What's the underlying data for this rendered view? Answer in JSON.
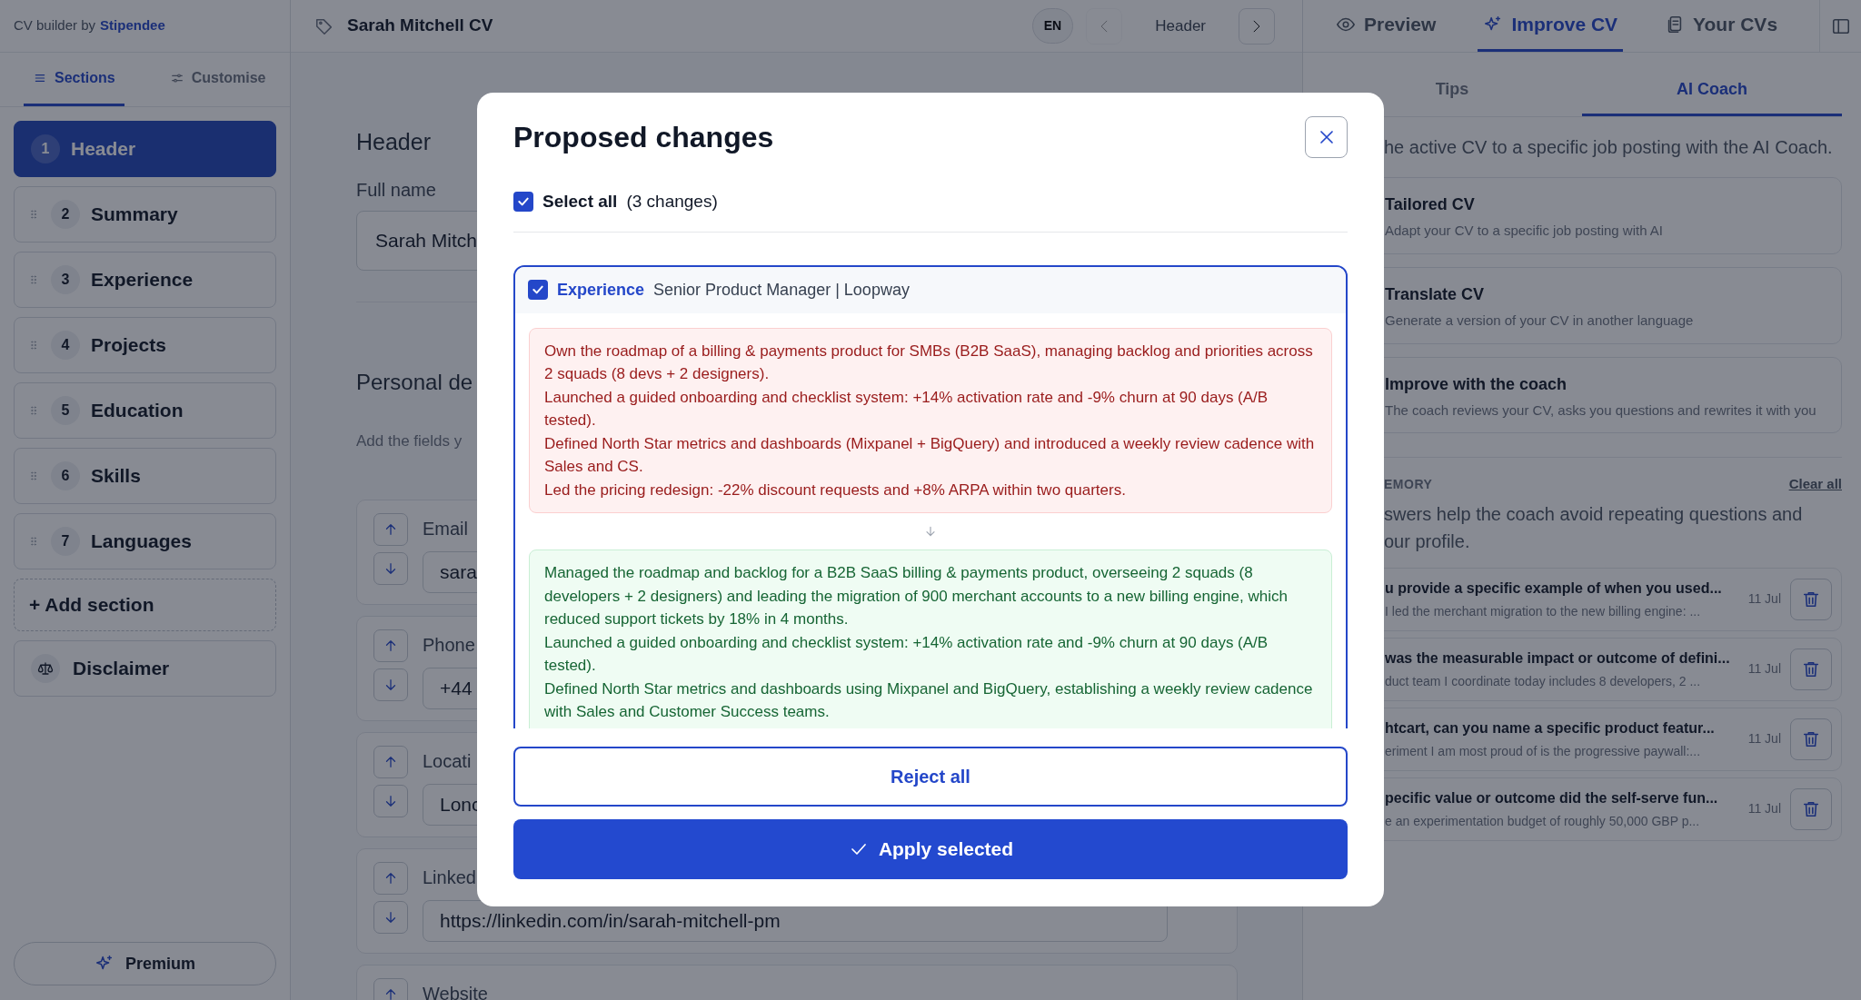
{
  "brand": {
    "prefix": "CV builder by",
    "name": "Stipendee"
  },
  "sidebar": {
    "tabs": [
      {
        "label": "Sections",
        "selected": true
      },
      {
        "label": "Customise",
        "selected": false
      }
    ],
    "sections": [
      {
        "number": "1",
        "label": "Header",
        "selected": true,
        "draggable": false
      },
      {
        "number": "2",
        "label": "Summary",
        "selected": false,
        "draggable": true
      },
      {
        "number": "3",
        "label": "Experience",
        "selected": false,
        "draggable": true
      },
      {
        "number": "4",
        "label": "Projects",
        "selected": false,
        "draggable": true
      },
      {
        "number": "5",
        "label": "Education",
        "selected": false,
        "draggable": true
      },
      {
        "number": "6",
        "label": "Skills",
        "selected": false,
        "draggable": true
      },
      {
        "number": "7",
        "label": "Languages",
        "selected": false,
        "draggable": true
      }
    ],
    "add_section": "+ Add section",
    "disclaimer": "Disclaimer",
    "premium": "Premium"
  },
  "topbar": {
    "title": "Sarah Mitchell CV",
    "language": "EN",
    "prev": {
      "disabled": true
    },
    "current_section": "Header",
    "next": {
      "disabled": false
    }
  },
  "editor": {
    "title": "Header",
    "full_name_label": "Full name",
    "full_name_value": "Sarah Mitch",
    "personal_title": "Personal de",
    "personal_hint": "Add the fields y",
    "fields": [
      {
        "label": "Email",
        "value": "sara"
      },
      {
        "label": "Phone",
        "value": "+44"
      },
      {
        "label": "Locati",
        "value": "Lonc"
      },
      {
        "label": "Linked",
        "value": "https://linkedin.com/in/sarah-mitchell-pm"
      },
      {
        "label": "Website"
      }
    ]
  },
  "right_panel": {
    "tabs": [
      {
        "label": "Preview",
        "selected": false
      },
      {
        "label": "Improve CV",
        "selected": true
      },
      {
        "label": "Your CVs",
        "selected": false
      }
    ],
    "subtabs": [
      {
        "label": "Tips",
        "selected": false
      },
      {
        "label": "AI Coach",
        "selected": true
      }
    ],
    "intro": "he active CV to a specific job posting with the AI Coach.",
    "tools": [
      {
        "title": "Tailored CV",
        "description": "Adapt your CV to a specific job posting with AI"
      },
      {
        "title": "Translate CV",
        "description": "Generate a version of your CV in another language"
      },
      {
        "title": "Improve with the coach",
        "description": "The coach reviews your CV, asks you questions and rewrites it with you"
      }
    ],
    "memory": {
      "heading": "EMORY",
      "clear": "Clear all",
      "description": [
        "swers help the coach avoid repeating questions and",
        "our profile."
      ],
      "items": [
        {
          "question": "u provide a specific example of when you used...",
          "answer": "I led the merchant migration to the new billing engine: ...",
          "date": "11 Jul"
        },
        {
          "question": "was the measurable impact or outcome of defini...",
          "answer": "duct team I coordinate today includes 8 developers, 2 ...",
          "date": "11 Jul"
        },
        {
          "question": "htcart, can you name a specific product featur...",
          "answer": "eriment I am most proud of is the progressive paywall:...",
          "date": "11 Jul"
        },
        {
          "question": "pecific value or outcome did the self-serve fun...",
          "answer": "e an experimentation budget of roughly 50,000 GBP p...",
          "date": "11 Jul"
        }
      ]
    }
  },
  "modal": {
    "title": "Proposed changes",
    "select_all": {
      "label": "Select all",
      "count": "(3 changes)",
      "checked": true
    },
    "changes": [
      {
        "checked": true,
        "section": "Experience",
        "target": "Senior Product Manager | Loopway",
        "before": [
          "Own the roadmap of a billing & payments product for SMBs (B2B SaaS), managing backlog and priorities across 2 squads (8 devs + 2 designers).",
          "Launched a guided onboarding and checklist system: +14% activation rate and -9% churn at 90 days (A/B tested).",
          "Defined North Star metrics and dashboards (Mixpanel + BigQuery) and introduced a weekly review cadence with Sales and CS.",
          "Led the pricing redesign: -22% discount requests and +8% ARPA within two quarters."
        ],
        "after": [
          "Managed the roadmap and backlog for a B2B SaaS billing & payments product, overseeing 2 squads (8 developers + 2 designers) and leading the migration of 900 merchant accounts to a new billing engine, which reduced support tickets by 18% in 4 months.",
          "Launched a guided onboarding and checklist system: +14% activation rate and -9% churn at 90 days (A/B tested).",
          "Defined North Star metrics and dashboards using Mixpanel and BigQuery, establishing a weekly review cadence with Sales and Customer Success teams."
        ]
      }
    ],
    "reject": "Reject all",
    "apply": "Apply selected"
  }
}
